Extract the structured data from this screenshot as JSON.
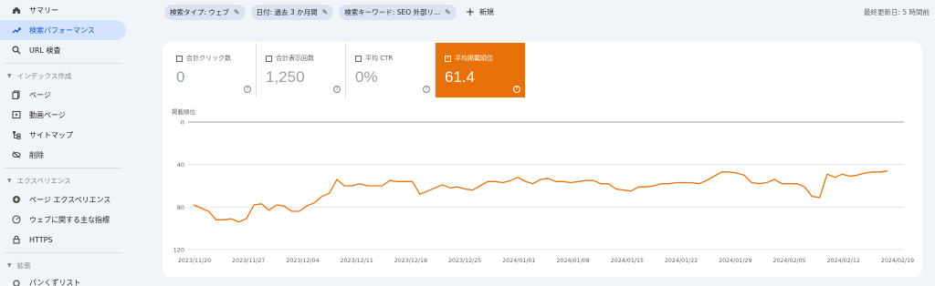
{
  "sidebar": {
    "items_top": [
      {
        "label": "サマリー",
        "icon": "home-icon"
      },
      {
        "label": "検索パフォーマンス",
        "icon": "trending-icon",
        "active": true
      },
      {
        "label": "URL 検査",
        "icon": "search-icon"
      }
    ],
    "section_index": "インデックス作成",
    "items_index": [
      {
        "label": "ページ",
        "icon": "pages-icon"
      },
      {
        "label": "動画ページ",
        "icon": "video-icon"
      },
      {
        "label": "サイトマップ",
        "icon": "sitemap-icon"
      },
      {
        "label": "削除",
        "icon": "eye-off-icon"
      }
    ],
    "section_experience": "エクスペリエンス",
    "items_experience": [
      {
        "label": "ページ エクスペリエンス",
        "icon": "plus-circle-icon"
      },
      {
        "label": "ウェブに関する主な指標",
        "icon": "gauge-icon"
      },
      {
        "label": "HTTPS",
        "icon": "lock-icon"
      }
    ],
    "section_ext": "拡張",
    "items_ext_partial": "パンくずリスト"
  },
  "filters": {
    "chips": [
      "検索タイプ: ウェブ",
      "日付: 過去 3 か月間",
      "検索キーワード: SEO 外部リ..."
    ],
    "new_label": "新規"
  },
  "updated_text": "最終更新日: 5 時間前",
  "metrics": [
    {
      "label": "合計クリック数",
      "value": "0",
      "selected": false
    },
    {
      "label": "合計表示回数",
      "value": "1,250",
      "selected": false
    },
    {
      "label": "平均 CTR",
      "value": "0%",
      "selected": false
    },
    {
      "label": "平均掲載順位",
      "value": "61.4",
      "selected": true
    }
  ],
  "colors": {
    "accent": "#e8710a",
    "active_nav": "#d3e3fd"
  },
  "chart_data": {
    "type": "line",
    "title": "",
    "ylabel": "掲載順位",
    "y_reversed": true,
    "ylim": [
      0,
      120
    ],
    "yticks": [
      "0",
      "40",
      "80",
      "120"
    ],
    "xticks": [
      "2023/11/20",
      "2023/11/27",
      "2023/12/04",
      "2023/12/11",
      "2023/12/18",
      "2023/12/25",
      "2024/01/01",
      "2024/01/08",
      "2024/01/15",
      "2024/01/22",
      "2024/01/29",
      "2024/02/05",
      "2024/02/12",
      "2024/02/19"
    ],
    "series": [
      {
        "color": "#e8710a",
        "values": [
          78,
          81,
          84,
          92,
          92,
          91,
          94,
          91,
          78,
          77,
          83,
          78,
          79,
          84,
          84,
          79,
          76,
          70,
          67,
          54,
          60,
          60,
          58,
          60,
          60,
          60,
          55,
          56,
          56,
          56,
          68,
          65,
          62,
          59,
          62,
          61,
          63,
          64,
          60,
          56,
          56,
          57,
          55,
          52,
          56,
          58,
          54,
          53,
          56,
          56,
          57,
          56,
          55,
          55,
          58,
          58,
          63,
          64,
          65,
          61,
          61,
          60,
          58,
          58,
          57,
          57,
          57,
          58,
          55,
          51,
          47,
          47,
          48,
          50,
          57,
          58,
          57,
          54,
          58,
          58,
          58,
          61,
          70,
          71,
          49,
          52,
          49,
          51,
          50,
          48,
          47,
          47,
          46
        ]
      }
    ]
  }
}
